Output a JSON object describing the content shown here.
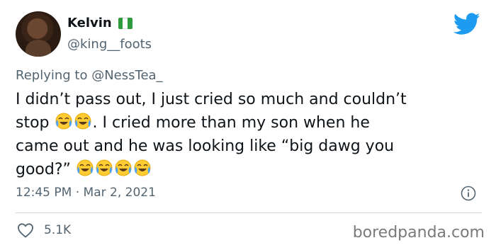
{
  "author": {
    "name": "Kelvin",
    "handle": "@king__foots"
  },
  "replying": {
    "prefix": "Replying to",
    "mention": "@NessTea_"
  },
  "tweet": {
    "line1": "I didn’t pass out, I just cried so much and couldn’t",
    "line2_start": "stop",
    "line2_end": ". I cried more than my son when he",
    "line3": "came out and he was looking like “big dawg you",
    "line4_start": "good?”"
  },
  "timestamp": "12:45 PM · Mar 2, 2021",
  "likes": "5.1K",
  "watermark": "boredpanda.com",
  "colors": {
    "twitter_blue": "#1d9bf0",
    "secondary_text": "#536471",
    "flag_green": "#2e9b3c"
  },
  "icons": [
    "nigeria-flag-icon",
    "twitter-bird-icon",
    "tears-of-joy-emoji",
    "info-icon",
    "heart-icon"
  ]
}
